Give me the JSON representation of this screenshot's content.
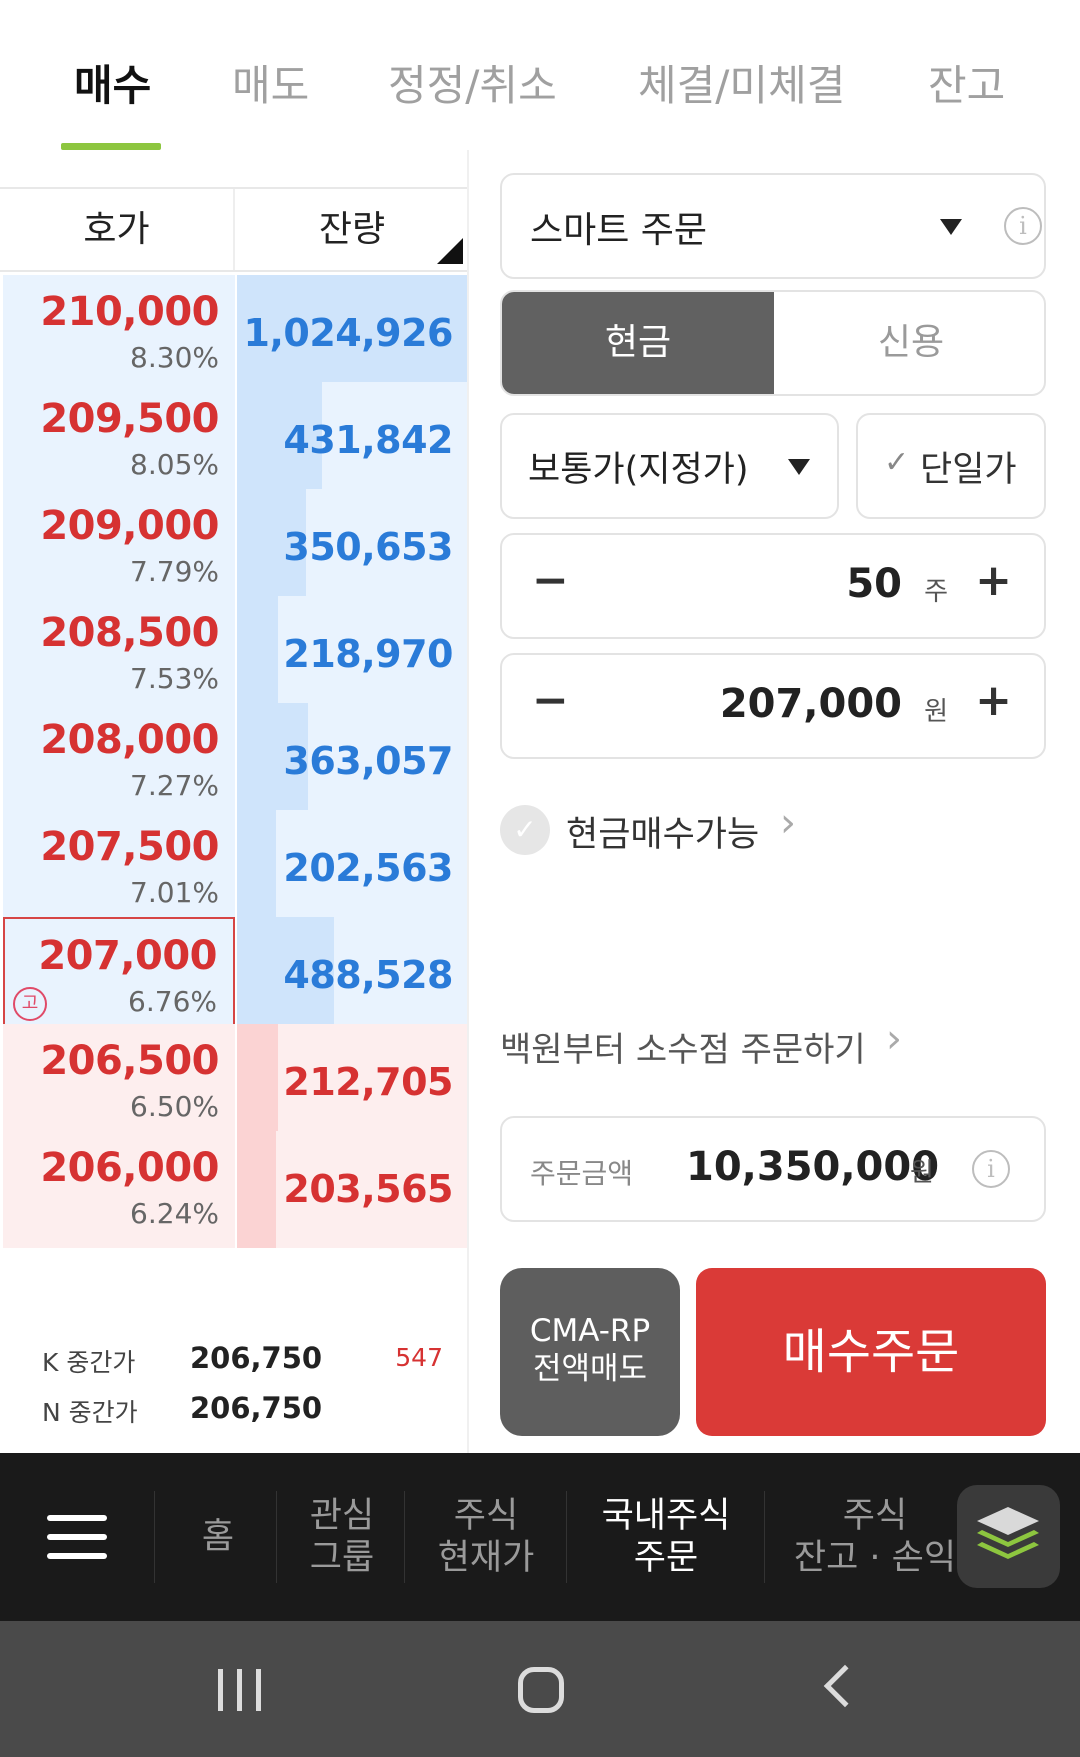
{
  "tabs": [
    {
      "label": "매수",
      "active": true
    },
    {
      "label": "매도",
      "active": false
    },
    {
      "label": "정정/취소",
      "active": false
    },
    {
      "label": "체결/미체결",
      "active": false
    },
    {
      "label": "잔고",
      "active": false
    }
  ],
  "orderbook": {
    "header_price": "호가",
    "header_qty": "잔량",
    "rows": [
      {
        "side": "sell",
        "price": "210,000",
        "rate": "8.30%",
        "qty": "1,024,926",
        "bar_fraction": 1.0
      },
      {
        "side": "sell",
        "price": "209,500",
        "rate": "8.05%",
        "qty": "431,842",
        "bar_fraction": 0.37
      },
      {
        "side": "sell",
        "price": "209,000",
        "rate": "7.79%",
        "qty": "350,653",
        "bar_fraction": 0.3
      },
      {
        "side": "sell",
        "price": "208,500",
        "rate": "7.53%",
        "qty": "218,970",
        "bar_fraction": 0.18
      },
      {
        "side": "sell",
        "price": "208,000",
        "rate": "7.27%",
        "qty": "363,057",
        "bar_fraction": 0.31
      },
      {
        "side": "sell",
        "price": "207,500",
        "rate": "7.01%",
        "qty": "202,563",
        "bar_fraction": 0.17
      },
      {
        "side": "sell",
        "price": "207,000",
        "rate": "6.76%",
        "qty": "488,528",
        "bar_fraction": 0.42,
        "current": true,
        "badge": "고"
      },
      {
        "side": "buy",
        "price": "206,500",
        "rate": "6.50%",
        "qty": "212,705",
        "bar_fraction": 0.18
      },
      {
        "side": "buy",
        "price": "206,000",
        "rate": "6.24%",
        "qty": "203,565",
        "bar_fraction": 0.17
      }
    ],
    "mid_k_label": "K 중간가",
    "mid_k_value": "206,750",
    "mid_k_count": "547",
    "mid_n_label": "N 중간가",
    "mid_n_value": "206,750"
  },
  "order": {
    "type_label": "스마트 주문",
    "info_icon": "i",
    "account_cash": "현금",
    "account_credit": "신용",
    "price_type": "보통가(지정가)",
    "single_price": "단일가",
    "quantity": "50",
    "quantity_unit": "주",
    "price": "207,000",
    "price_unit": "원",
    "minus": "−",
    "plus": "+",
    "cash_available": "현금매수가능",
    "fractional_link": "백원부터 소수점 주문하기",
    "amount_label": "주문금액",
    "amount_value": "10,350,000",
    "amount_unit": "원",
    "cma_button_line1": "CMA-RP",
    "cma_button_line2": "전액매도",
    "buy_button": "매수주문"
  },
  "bottom_nav": {
    "home": "홈",
    "watch_line1": "관심",
    "watch_line2": "그룹",
    "quote_line1": "주식",
    "quote_line2": "현재가",
    "order_line1": "국내주식",
    "order_line2": "주문",
    "balance_line1": "주식",
    "balance_line2": "잔고 · 손익"
  },
  "colors": {
    "accent_green": "#8dc63f",
    "ask_blue": "#2a7bd8",
    "bid_red": "#d63232",
    "buy_button": "#da3a37"
  },
  "icons": [
    "info-icon",
    "dropdown-triangle-icon",
    "check-icon",
    "chevron-right-icon",
    "menu-icon",
    "layers-icon",
    "recents-icon",
    "home-icon",
    "back-icon"
  ]
}
